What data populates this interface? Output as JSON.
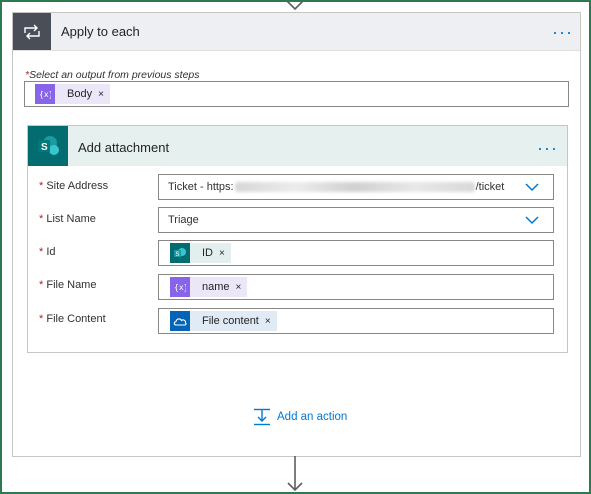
{
  "outer": {
    "title": "Apply to each",
    "select_label": "Select an output from previous steps",
    "required_mark": "*",
    "token": {
      "label": "Body",
      "remove": "×",
      "icon": "expression-icon",
      "color": "#8764e8"
    }
  },
  "inner": {
    "title": "Add attachment",
    "icon": "sharepoint-icon",
    "rows": [
      {
        "label": "Site Address",
        "value_prefix": "Ticket - https:",
        "value_suffix": "/ticket",
        "has_dropdown": true
      },
      {
        "label": "List Name",
        "value": "Triage",
        "has_dropdown": true
      },
      {
        "label": "Id",
        "token": {
          "label": "ID",
          "remove": "×",
          "icon": "sharepoint-icon",
          "color": "#036c70"
        }
      },
      {
        "label": "File Name",
        "token": {
          "label": "name",
          "remove": "×",
          "icon": "expression-icon",
          "color": "#8764e8"
        }
      },
      {
        "label": "File Content",
        "token": {
          "label": "File content",
          "remove": "×",
          "icon": "onedrive-icon",
          "color": "#0364b8"
        }
      }
    ]
  },
  "more_label": "···",
  "add_action": {
    "label": "Add an action",
    "icon": "add-step-icon"
  },
  "colors": {
    "accent": "#0078d4",
    "frame": "#2d7a52"
  }
}
